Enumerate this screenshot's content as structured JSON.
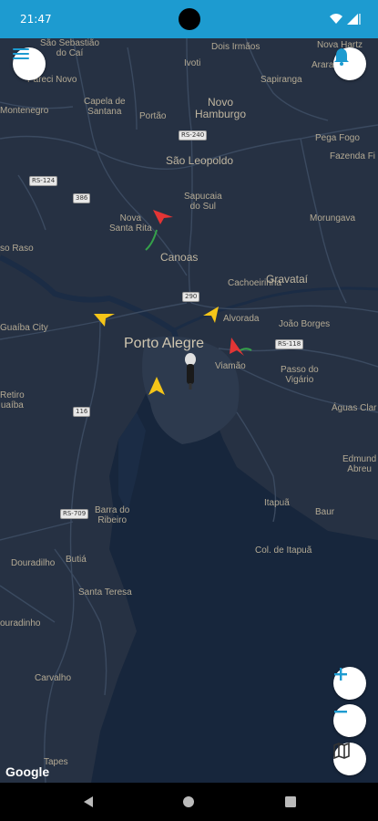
{
  "status_bar": {
    "time": "21:47"
  },
  "map": {
    "attribution": "Google",
    "places": {
      "sao_sebastiao": "São Sebastião\ndo Caí",
      "dois_irmaos": "Dois Irmãos",
      "nova_hartz": "Nova Hartz",
      "ivoti": "Ivoti",
      "arara": "Arara",
      "capela": "Capela de\nSantana",
      "portao": "Portão",
      "novo_hamburgo": "Novo\nHamburgo",
      "sapiranga": "Sapiranga",
      "montenegro": "Montenegro",
      "pareci": "Pareci Novo",
      "pega_fogo": "Pega Fogo",
      "fazenda": "Fazenda Fi",
      "sao_leopoldo": "São Leopoldo",
      "sapucaia": "Sapucaia\ndo Sul",
      "morungava": "Morungava",
      "nova_santa_rita": "Nova\nSanta Rita",
      "passo_raso": "so Raso",
      "canoas": "Canoas",
      "cachoeirinha": "Cachoeirinha",
      "gravatai": "Gravataí",
      "guaiba": "Guaíba City",
      "alvorada": "Alvorada",
      "joao_borges": "João Borges",
      "porto_alegre": "Porto Alegre",
      "viamao": "Viamão",
      "passo_vigario": "Passo do\nVigário",
      "retiro": "Retiro\nuaíba",
      "aguas_claras": "Águas Clar",
      "edmundo": "Edmund\nAbreu",
      "barra_ribeiro": "Barra do\nRibeiro",
      "itapua": "Itapuã",
      "baur": "Baur",
      "col_itapua": "Col. de Itapuã",
      "douradilho": "Douradilho",
      "butia": "Butiá",
      "santa_teresa": "Santa Teresa",
      "douradinho": "ouradinho",
      "carvalho": "Carvalho",
      "tapes": "Tapes"
    },
    "shields": {
      "rs124": "RS-124",
      "br386": "386",
      "rs240": "RS-240",
      "br290": "290",
      "rs118": "RS-118",
      "br116": "116",
      "rs709": "RS-709"
    }
  },
  "buttons": {
    "menu_icon": "menu-icon",
    "notifications_icon": "bell-icon",
    "zoom_in_icon": "plus-icon",
    "zoom_out_icon": "minus-icon",
    "map_type_icon": "map-icon"
  },
  "colors": {
    "accent": "#1d9bd0",
    "map_land": "#263143",
    "water": "#17263c",
    "marker_red": "#e33535",
    "marker_yellow": "#f5c518"
  }
}
